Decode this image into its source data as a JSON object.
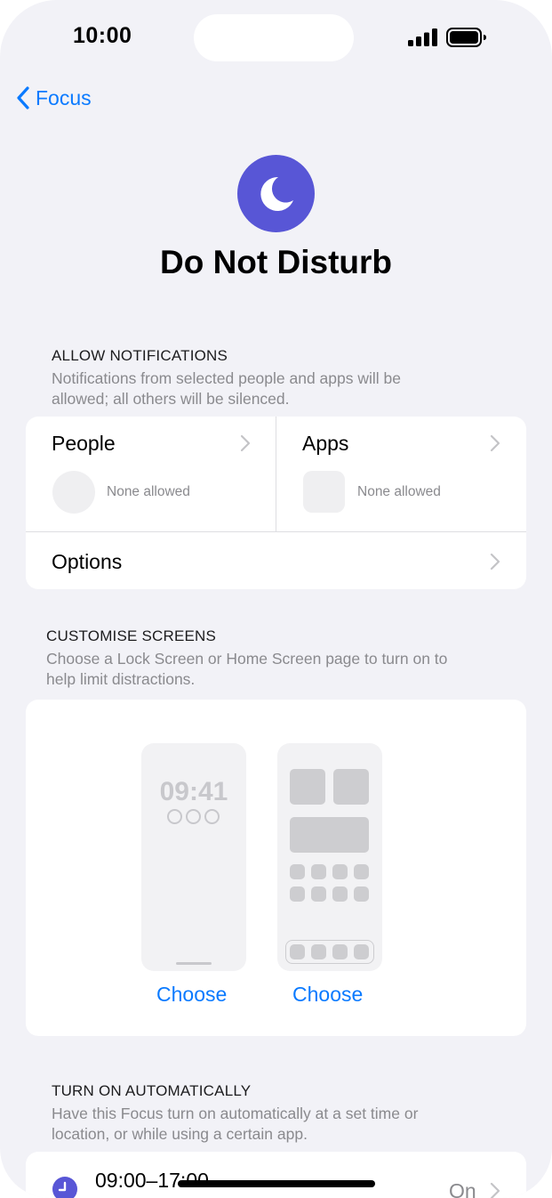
{
  "status_bar": {
    "time": "10:00"
  },
  "nav": {
    "back_label": "Focus"
  },
  "focus": {
    "title": "Do Not Disturb",
    "icon": "moon-icon",
    "accent": "#5856d6"
  },
  "allow_notifications": {
    "header": "ALLOW NOTIFICATIONS",
    "description_line1": "Notifications from selected people and apps will be",
    "description_line2": "allowed; all others will be silenced.",
    "people": {
      "label": "People",
      "status": "None allowed"
    },
    "apps": {
      "label": "Apps",
      "status": "None allowed"
    },
    "options": {
      "label": "Options"
    }
  },
  "customise_screens": {
    "header": "CUSTOMISE SCREENS",
    "description_line1": "Choose a Lock Screen or Home Screen page to turn on to",
    "description_line2": "help limit distractions.",
    "lock_preview_time": "09:41",
    "lock_choose": "Choose",
    "home_choose": "Choose"
  },
  "turn_on_automatically": {
    "header": "TURN ON AUTOMATICALLY",
    "description_line1": "Have this Focus turn on automatically at a set time or",
    "description_line2": "location, or while using a certain app.",
    "schedule": {
      "time": "09:00–17:00",
      "state": "On"
    }
  },
  "colors": {
    "link": "#0a7aff",
    "background": "#f2f2f7"
  }
}
